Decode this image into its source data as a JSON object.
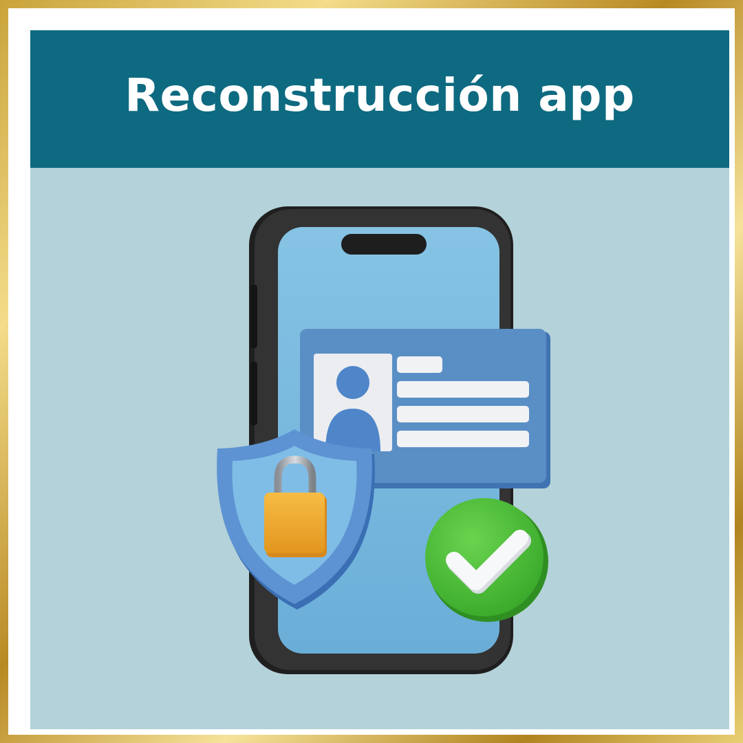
{
  "header": {
    "title": "Reconstrucción app"
  },
  "illustration": {
    "icons": [
      "smartphone-icon",
      "id-card-icon",
      "user-avatar-icon",
      "shield-icon",
      "padlock-icon",
      "checkmark-icon"
    ]
  },
  "colors": {
    "border_gold": "#d4af4a",
    "header_bg": "#0e6a80",
    "canvas_bg": "#b4d2d9",
    "phone_body": "#2b2b2b",
    "phone_screen": "#7ab8dc",
    "card_blue": "#5a8fc6",
    "shield_blue": "#4f86c9",
    "lock_orange": "#f2a830",
    "check_green": "#4ec43a"
  }
}
